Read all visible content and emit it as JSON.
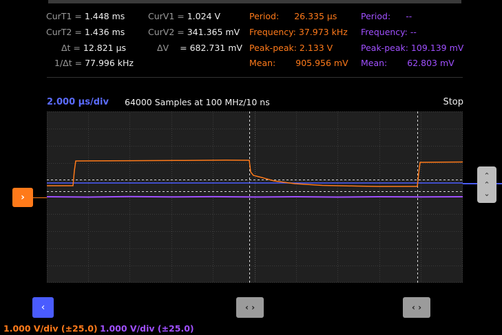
{
  "cursors": {
    "curT1": {
      "label": "CurT1 =",
      "value": "1.448 ms"
    },
    "curT2": {
      "label": "CurT2 =",
      "value": "1.436 ms"
    },
    "dt": {
      "label": "Δt =",
      "value": "12.821 µs"
    },
    "inv_dt": {
      "label": "1/Δt =",
      "value": "77.996 kHz"
    },
    "curV1": {
      "label": "CurV1 =",
      "value": "1.024 V"
    },
    "curV2": {
      "label": "CurV2 =",
      "value": "341.365 mV"
    },
    "dv": {
      "label": "ΔV",
      "eq": "=",
      "value": "682.731 mV"
    }
  },
  "measurements_ch1": {
    "color": "#ff7a1a",
    "period": {
      "label": "Period:",
      "value": "26.335 µs"
    },
    "frequency": {
      "label": "Frequency:",
      "value": "37.973 kHz"
    },
    "peak_peak": {
      "label": "Peak-peak:",
      "value": "2.133 V"
    },
    "mean": {
      "label": "Mean:",
      "value": "905.956 mV"
    }
  },
  "measurements_ch2": {
    "color": "#a050ff",
    "period": {
      "label": "Period:",
      "value": "--"
    },
    "frequency": {
      "label": "Frequency:",
      "value": "--"
    },
    "peak_peak": {
      "label": "Peak-peak:",
      "value": "109.139 mV"
    },
    "mean": {
      "label": "Mean:",
      "value": "62.803 mV"
    }
  },
  "timebase": {
    "label": "2.000 µs/div",
    "color": "#5b6cff"
  },
  "samples_text": "64000 Samples at 100 MHz/10 ns",
  "run_state": "Stop",
  "channels": {
    "ch1": {
      "label": "1.000 V/div (±25.0)",
      "color": "#ff7a1a"
    },
    "ch2": {
      "label": "1.000 V/div (±25.0)",
      "color": "#a050ff"
    }
  },
  "icons": {
    "channel_marker": "›",
    "left": "‹",
    "expand": "‹ ›",
    "up": "⌃",
    "down": "⌄"
  }
}
